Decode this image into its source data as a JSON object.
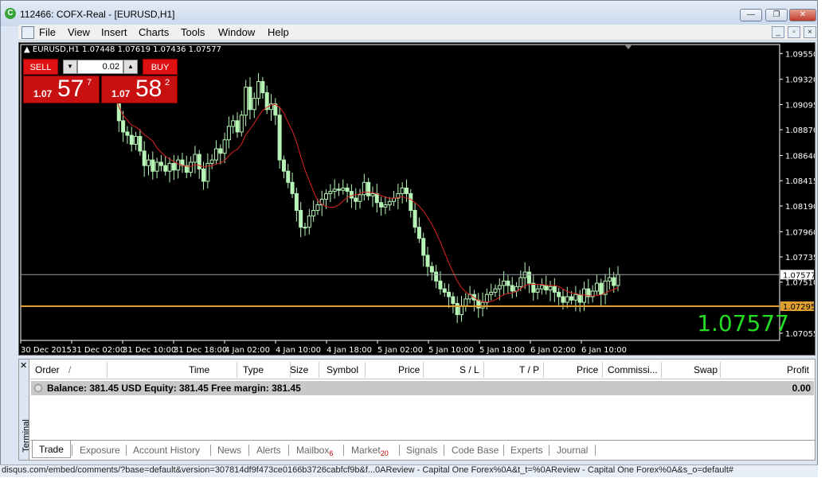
{
  "window": {
    "title": "112466: COFX-Real - [EURUSD,H1]",
    "controls": {
      "minimize": "—",
      "restore": "❐",
      "close": "✕"
    }
  },
  "menu": [
    "File",
    "View",
    "Insert",
    "Charts",
    "Tools",
    "Window",
    "Help"
  ],
  "chart_header": "▲ EURUSD,H1  1.07448 1.07619 1.07436 1.07577",
  "trade_panel": {
    "sell_label": "SELL",
    "buy_label": "BUY",
    "lot": "0.02",
    "sell": {
      "prefix": "1.07",
      "big": "57",
      "sup": "7"
    },
    "buy": {
      "prefix": "1.07",
      "big": "58",
      "sup": "2"
    }
  },
  "current_price": "1.07577",
  "chart_data": {
    "type": "candlestick",
    "symbol": "EURUSD",
    "timeframe": "H1",
    "y_ticks": [
      "1.09550",
      "1.09320",
      "1.09095",
      "1.08870",
      "1.08640",
      "1.08415",
      "1.08190",
      "1.07960",
      "1.07735",
      "1.07510",
      "1.07055"
    ],
    "x_ticks": [
      "30 Dec 2015",
      "31 Dec 02:00",
      "31 Dec 10:00",
      "31 Dec 18:00",
      "4 Jan 02:00",
      "4 Jan 10:00",
      "4 Jan 18:00",
      "5 Jan 02:00",
      "5 Jan 10:00",
      "5 Jan 18:00",
      "6 Jan 02:00",
      "6 Jan 10:00"
    ],
    "ylim": [
      1.0699,
      1.0963
    ],
    "bid_line": {
      "value": 1.07577,
      "label": "1.07577",
      "color": "#9aa0a6"
    },
    "level_line": {
      "value": 1.07295,
      "label": "1.07295",
      "color": "#e0a030"
    },
    "ma_color": "#dd2222",
    "candle_color": "#b6f5b6",
    "closes": [
      1.092,
      1.0895,
      1.0885,
      1.0882,
      1.0874,
      1.0881,
      1.0868,
      1.0855,
      1.086,
      1.085,
      1.0858,
      1.0855,
      1.085,
      1.0857,
      1.0851,
      1.086,
      1.0855,
      1.0849,
      1.0858,
      1.0865,
      1.0852,
      1.0841,
      1.0857,
      1.086,
      1.087,
      1.0866,
      1.0878,
      1.089,
      1.0895,
      1.0885,
      1.09,
      1.0925,
      1.0905,
      1.0915,
      1.093,
      1.092,
      1.0905,
      1.091,
      1.09,
      1.086,
      1.085,
      1.084,
      1.083,
      1.0815,
      1.08,
      1.08,
      1.081,
      1.0815,
      1.082,
      1.0825,
      1.083,
      1.0832,
      1.0834,
      1.0833,
      1.0835,
      1.0832,
      1.0826,
      1.0823,
      1.0829,
      1.084,
      1.0828,
      1.083,
      1.0822,
      1.0818,
      1.082,
      1.0823,
      1.0826,
      1.083,
      1.0835,
      1.083,
      1.0815,
      1.08,
      1.079,
      1.0775,
      1.0765,
      1.076,
      1.0752,
      1.0745,
      1.0742,
      1.0738,
      1.0732,
      1.0722,
      1.073,
      1.0736,
      1.074,
      1.0735,
      1.0728,
      1.0733,
      1.074,
      1.0742,
      1.0745,
      1.0748,
      1.0752,
      1.0748,
      1.0743,
      1.0747,
      1.0755,
      1.076,
      1.075,
      1.0742,
      1.0745,
      1.0748,
      1.0744,
      1.0747,
      1.0742,
      1.0738,
      1.0733,
      1.0738,
      1.0735,
      1.074,
      1.0733,
      1.0745,
      1.0738,
      1.0743,
      1.075,
      1.074,
      1.0752,
      1.0755,
      1.0748,
      1.07577
    ]
  },
  "terminal": {
    "side_label": "Terminal",
    "columns": [
      "Order",
      "/",
      "Time",
      "Type",
      "Size",
      "Symbol",
      "Price",
      "S / L",
      "T / P",
      "Price",
      "Commissi...",
      "Swap",
      "Profit"
    ],
    "balance_text": "Balance: 381.45 USD  Equity: 381.45  Free margin: 381.45",
    "balance_profit": "0.00",
    "tabs": [
      {
        "label": "Trade",
        "badge": ""
      },
      {
        "label": "Exposure",
        "badge": ""
      },
      {
        "label": "Account History",
        "badge": ""
      },
      {
        "label": "News",
        "badge": ""
      },
      {
        "label": "Alerts",
        "badge": ""
      },
      {
        "label": "Mailbox",
        "badge": "6"
      },
      {
        "label": "Market",
        "badge": "20"
      },
      {
        "label": "Signals",
        "badge": ""
      },
      {
        "label": "Code Base",
        "badge": ""
      },
      {
        "label": "Experts",
        "badge": ""
      },
      {
        "label": "Journal",
        "badge": ""
      }
    ]
  },
  "status_text": "disqus.com/embed/comments/?base=default&version=307814df9f473ce0166b3726cabfcf9b&f...0AReview - Capital One Forex%0A&t_t=%0AReview - Capital One Forex%0A&s_o=default#"
}
